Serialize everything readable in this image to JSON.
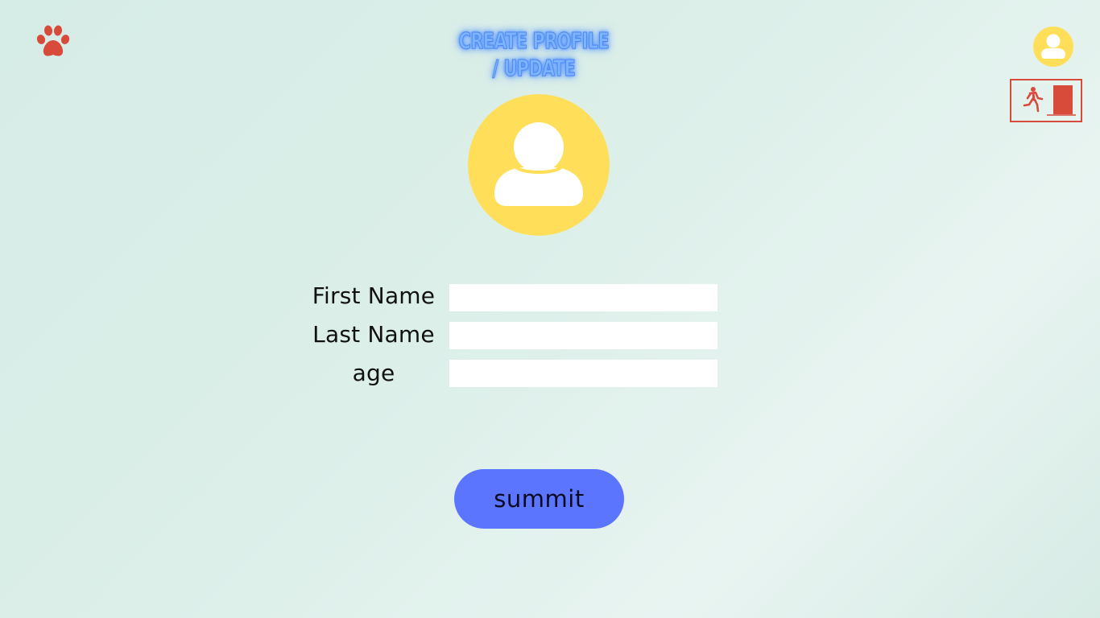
{
  "header": {
    "title_line1": "CREATE PROFILE",
    "title_line2": "/ UPDATE",
    "logo_icon": "paw-icon",
    "account_icon": "user-avatar-icon",
    "exit_icon": "exit-door-icon"
  },
  "form": {
    "fields": [
      {
        "label": "First Name",
        "value": "",
        "placeholder": ""
      },
      {
        "label": "Last Name",
        "value": "",
        "placeholder": ""
      },
      {
        "label": "age",
        "value": "",
        "placeholder": ""
      }
    ],
    "submit_label": "summit"
  },
  "colors": {
    "accent_red": "#d84a3a",
    "avatar_yellow": "#ffdf5a",
    "button_blue": "#5b75ff",
    "title_glow": "#4e8fff"
  }
}
